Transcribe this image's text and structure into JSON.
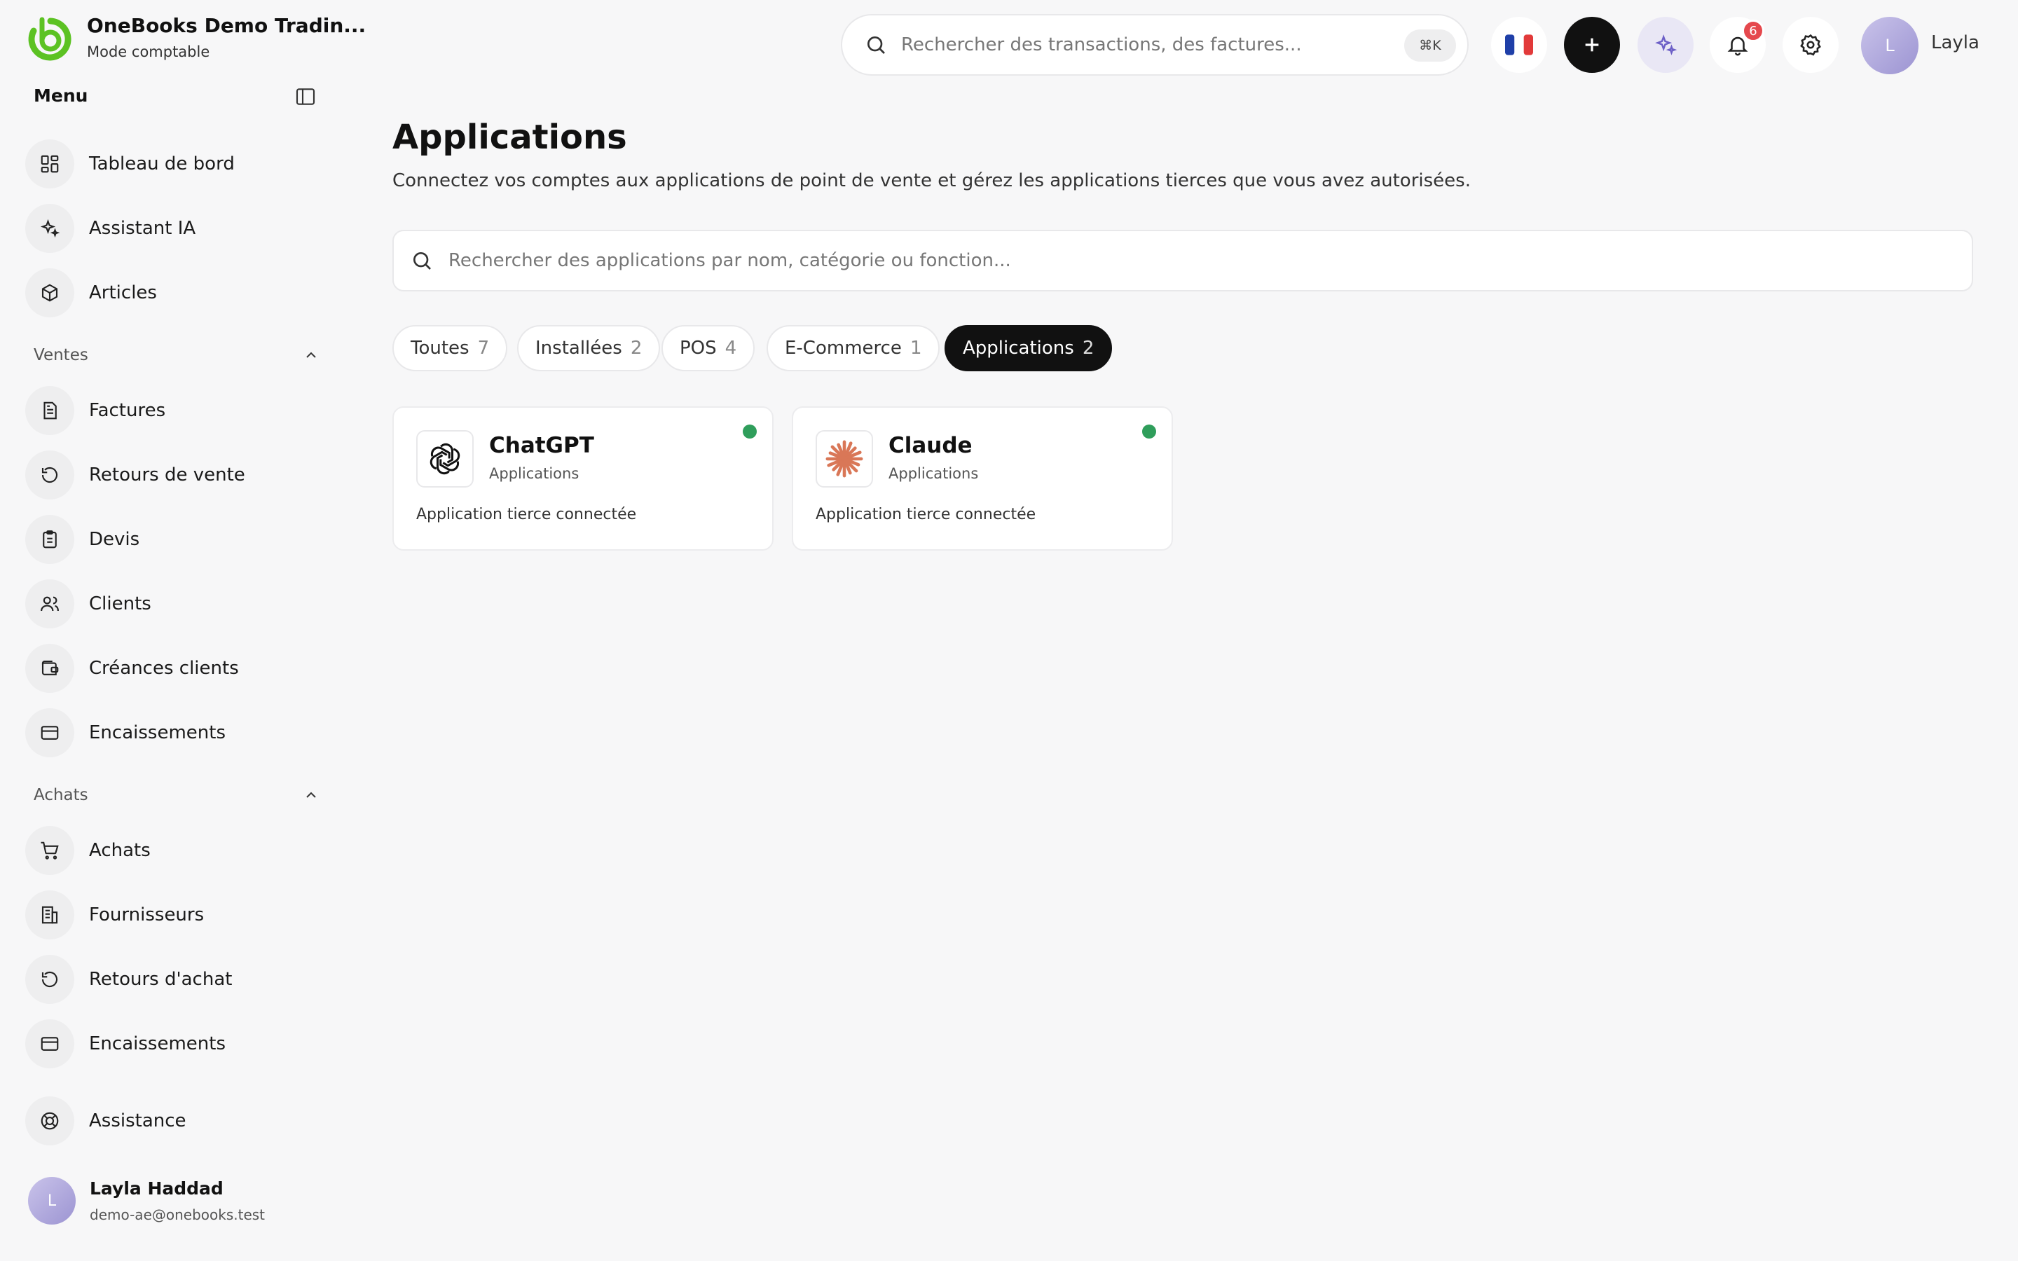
{
  "brand": {
    "name": "OneBooks Demo Tradin...",
    "mode": "Mode comptable"
  },
  "sidebar": {
    "menu_title": "Menu",
    "top_items": [
      {
        "label": "Tableau de bord",
        "icon": "dashboard-icon"
      },
      {
        "label": "Assistant IA",
        "icon": "sparkles-icon"
      },
      {
        "label": "Articles",
        "icon": "box-icon"
      }
    ],
    "sales_section": {
      "title": "Ventes",
      "items": [
        {
          "label": "Factures",
          "icon": "invoice-icon"
        },
        {
          "label": "Retours de vente",
          "icon": "return-icon"
        },
        {
          "label": "Devis",
          "icon": "quote-icon"
        },
        {
          "label": "Clients",
          "icon": "users-icon"
        },
        {
          "label": "Créances clients",
          "icon": "wallet-icon"
        },
        {
          "label": "Encaissements",
          "icon": "card-icon"
        }
      ]
    },
    "purchases_section": {
      "title": "Achats",
      "items": [
        {
          "label": "Achats",
          "icon": "cart-icon"
        },
        {
          "label": "Fournisseurs",
          "icon": "building-icon"
        },
        {
          "label": "Retours d'achat",
          "icon": "return-icon"
        },
        {
          "label": "Encaissements",
          "icon": "card-icon"
        }
      ]
    },
    "support_label": "Assistance",
    "user": {
      "initial": "L",
      "name": "Layla Haddad",
      "email": "demo-ae@onebooks.test"
    }
  },
  "topbar": {
    "search_placeholder": "Rechercher des transactions, des factures...",
    "shortcut": "⌘K",
    "notifications_count": "6",
    "user_initial": "L",
    "user_name": "Layla"
  },
  "main": {
    "title": "Applications",
    "subtitle": "Connectez vos comptes aux applications de point de vente et gérez les applications tierces que vous avez autorisées.",
    "search_placeholder": "Rechercher des applications par nom, catégorie ou fonction...",
    "filters": [
      {
        "label": "Toutes",
        "count": "7",
        "active": false
      },
      {
        "label": "Installées",
        "count": "2",
        "active": false
      },
      {
        "label": "POS",
        "count": "4",
        "active": false
      },
      {
        "label": "E-Commerce",
        "count": "1",
        "active": false
      },
      {
        "label": "Applications",
        "count": "2",
        "active": true
      }
    ],
    "apps": [
      {
        "name": "ChatGPT",
        "category": "Applications",
        "description": "Application tierce connectée",
        "status": "connected",
        "icon": "chatgpt-logo-icon"
      },
      {
        "name": "Claude",
        "category": "Applications",
        "description": "Application tierce connectée",
        "status": "connected",
        "icon": "claude-logo-icon"
      }
    ]
  },
  "colors": {
    "brand_green": "#5cc223",
    "status_green": "#2f9e5b",
    "badge_red": "#e5484d",
    "claude_orange": "#d97757"
  }
}
